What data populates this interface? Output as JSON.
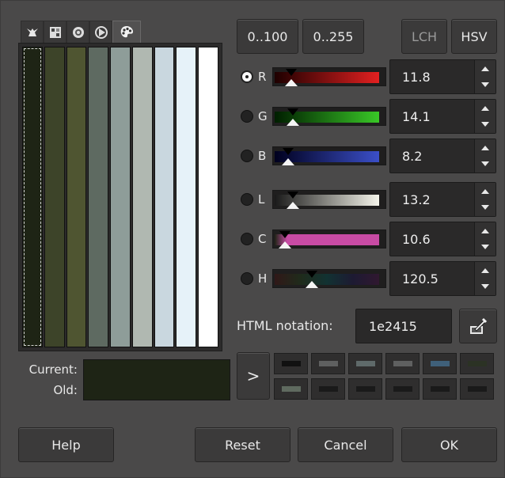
{
  "tabs": [
    {
      "icon": "wilber-icon"
    },
    {
      "icon": "cmyk-icon"
    },
    {
      "icon": "watercolor-icon"
    },
    {
      "icon": "triangle-icon"
    },
    {
      "icon": "palette-icon"
    }
  ],
  "palette": {
    "swatches": [
      "#1e2415",
      "#3d4429",
      "#4f5531",
      "#5e6a61",
      "#8e9d99",
      "#b0b8b1",
      "#c9d7df",
      "#e6f2f9",
      "#ffffff"
    ],
    "selected_index": 0
  },
  "range_buttons": {
    "range_100": "0..100",
    "range_255": "0..255"
  },
  "mode_buttons": {
    "lch": "LCH",
    "hsv": "HSV"
  },
  "channels": [
    {
      "key": "r",
      "label": "R",
      "value": "11.8",
      "checked": true
    },
    {
      "key": "g",
      "label": "G",
      "value": "14.1",
      "checked": false
    },
    {
      "key": "b",
      "label": "B",
      "value": "8.2",
      "checked": false
    },
    {
      "key": "l",
      "label": "L",
      "value": "13.2",
      "checked": false
    },
    {
      "key": "c",
      "label": "C",
      "value": "10.6",
      "checked": false
    },
    {
      "key": "h",
      "label": "H",
      "value": "120.5",
      "checked": false
    }
  ],
  "html_notation": {
    "label": "HTML notation:",
    "value": "1e2415"
  },
  "current_old": {
    "current_label": "Current:",
    "old_label": "Old:",
    "color": "#1e2415"
  },
  "history_arrow": ">",
  "history_swatches": [
    "#111111",
    "#5f6060",
    "#5f6a6a",
    "#5f6060",
    "#3f607a",
    "#2b3224",
    "#5f6a5f",
    "#1a1a1a",
    "#1a1a1a",
    "#1a1a1a",
    "#1a1a1a",
    "#1a1a1a"
  ],
  "footer": {
    "help": "Help",
    "reset": "Reset",
    "cancel": "Cancel",
    "ok": "OK"
  }
}
